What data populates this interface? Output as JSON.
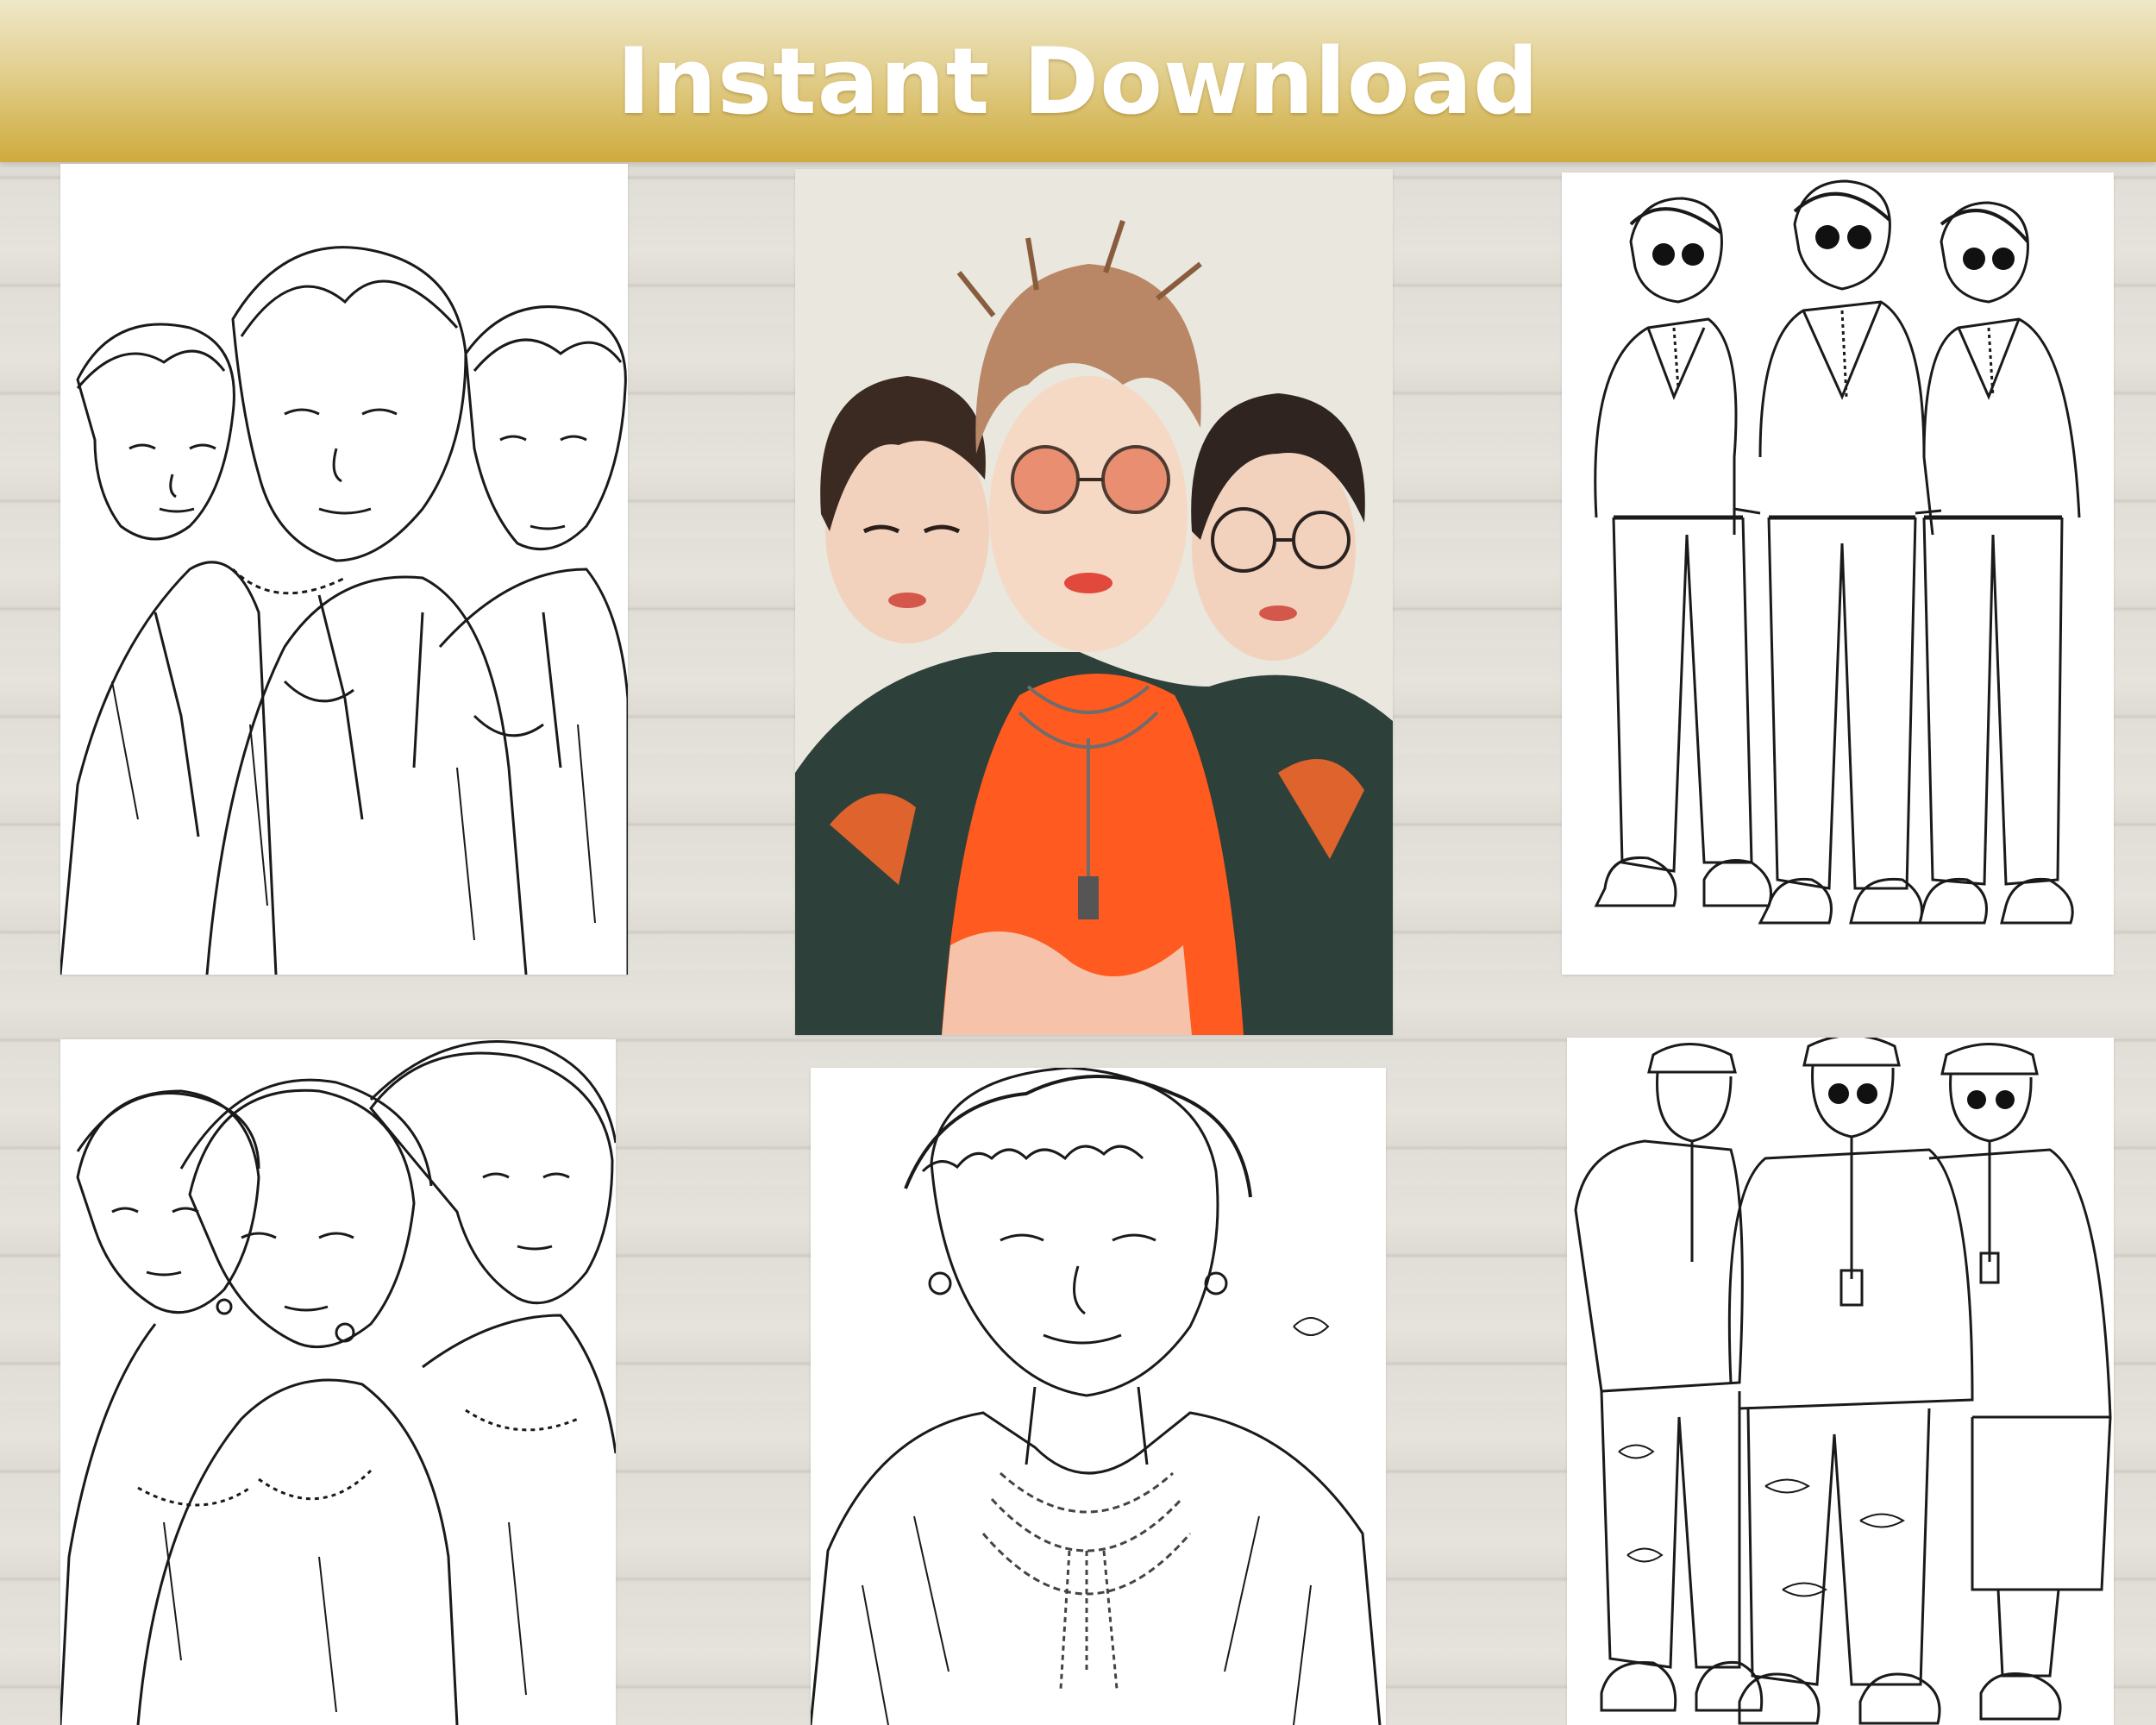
{
  "banner": {
    "title": "Instant Download"
  },
  "colors": {
    "banner_gold": "#cfab3d",
    "banner_light": "#efe8c8",
    "background_wood": "#e2dfd9",
    "accent_orange": "#ff5a1f",
    "ink": "#1a1a1a"
  },
  "cards": [
    {
      "style": "line-art",
      "subject": "three portraits, jackets"
    },
    {
      "style": "color",
      "subject": "three portraits, orange shirt, sunglasses"
    },
    {
      "style": "line-art",
      "subject": "three full-body figures, sunglasses"
    },
    {
      "style": "line-art",
      "subject": "three portraits, jackets"
    },
    {
      "style": "line-art",
      "subject": "single portrait with chains"
    },
    {
      "style": "line-art",
      "subject": "three full-body figures, caps, cargo pants"
    }
  ]
}
